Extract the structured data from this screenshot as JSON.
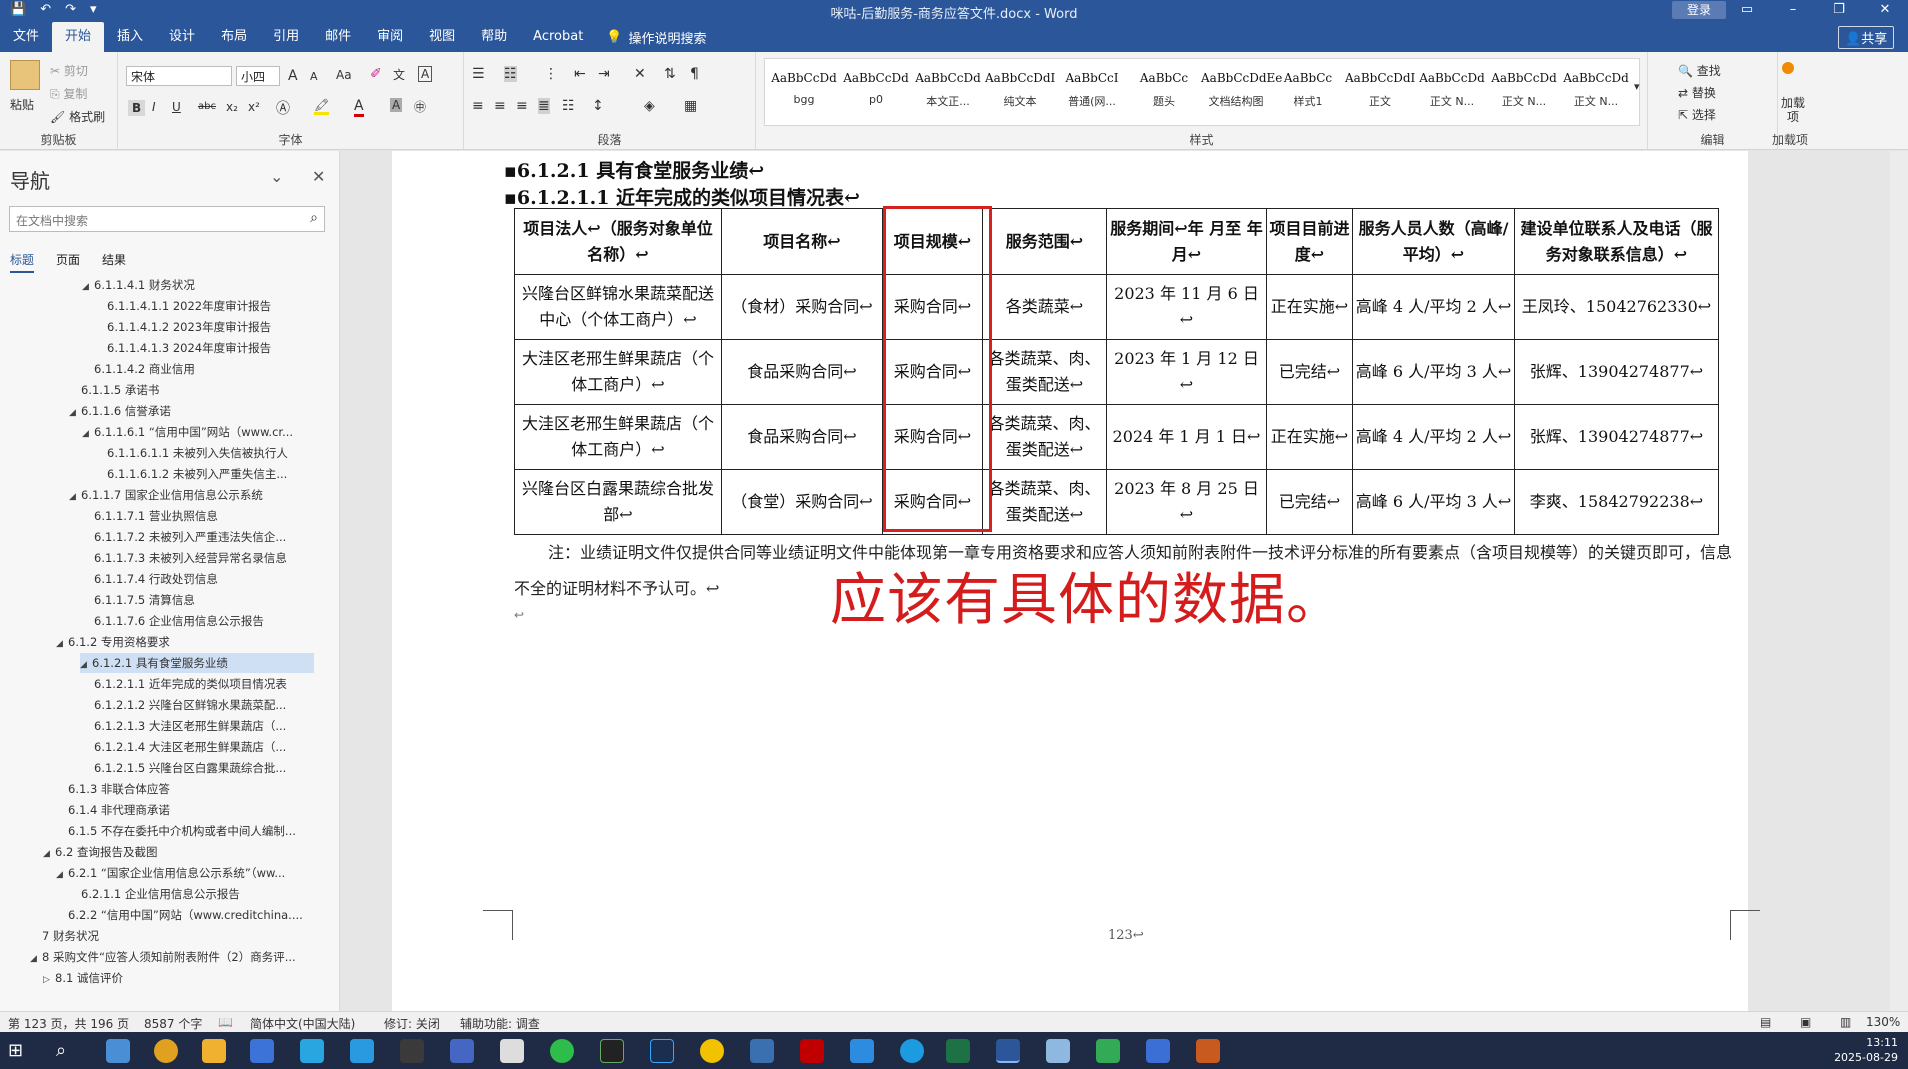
{
  "titlebar": {
    "title": "咪咕-后勤服务-商务应答文件.docx  -  Word",
    "login": "登录",
    "qa_save": "💾",
    "qa_undo": "↶",
    "qa_redo": "↷",
    "qa_more": "▾"
  },
  "tabs": [
    "文件",
    "开始",
    "插入",
    "设计",
    "布局",
    "引用",
    "邮件",
    "审阅",
    "视图",
    "帮助",
    "Acrobat"
  ],
  "tell_me": "操作说明搜索",
  "share": "共享",
  "ribbon": {
    "clipboard": {
      "paste": "粘贴",
      "cut": "剪切",
      "copy": "复制",
      "format_painter": "格式刷",
      "name": "剪贴板"
    },
    "font": {
      "font_name": "宋体",
      "font_size": "小四",
      "name": "字体",
      "grow": "A",
      "shrink": "A",
      "case": "Aa",
      "bold": "B",
      "italic": "I",
      "underline": "U",
      "strike": "abc",
      "sub": "x₂",
      "sup": "x²"
    },
    "paragraph": {
      "name": "段落"
    },
    "styles": {
      "name": "样式",
      "items": [
        {
          "sample": "AaBbCcDd",
          "name": "bgg"
        },
        {
          "sample": "AaBbCcDd",
          "name": "p0"
        },
        {
          "sample": "AaBbCcDd",
          "name": "本文正..."
        },
        {
          "sample": "AaBbCcDdI",
          "name": "纯文本"
        },
        {
          "sample": "AaBbCcI",
          "name": "普通(网..."
        },
        {
          "sample": "AaBbCc",
          "name": "题头"
        },
        {
          "sample": "AaBbCcDdEe",
          "name": "文档结构图"
        },
        {
          "sample": "AaBbCc",
          "name": "样式1"
        },
        {
          "sample": "AaBbCcDdI",
          "name": "正文"
        },
        {
          "sample": "AaBbCcDd",
          "name": "正文 N..."
        },
        {
          "sample": "AaBbCcDd",
          "name": "正文 N..."
        },
        {
          "sample": "AaBbCcDd",
          "name": "正文 N..."
        }
      ]
    },
    "editing": {
      "find": "查找",
      "replace": "替换",
      "select": "选择",
      "name": "编辑"
    },
    "addins": {
      "label": "加载项",
      "name": "加载项"
    }
  },
  "nav": {
    "title": "导航",
    "search_placeholder": "在文档中搜索",
    "tabs": [
      "标题",
      "页面",
      "结果"
    ],
    "outline": [
      {
        "t": "6.1.1.4.1 财务状况",
        "lvl": 4,
        "tri": "◢"
      },
      {
        "t": "6.1.1.4.1.1 2022年度审计报告",
        "lvl": 5,
        "tri": ""
      },
      {
        "t": "6.1.1.4.1.2 2023年度审计报告",
        "lvl": 5,
        "tri": ""
      },
      {
        "t": "6.1.1.4.1.3 2024年度审计报告",
        "lvl": 5,
        "tri": ""
      },
      {
        "t": "6.1.1.4.2 商业信用",
        "lvl": 4,
        "tri": ""
      },
      {
        "t": "6.1.1.5 承诺书",
        "lvl": 3,
        "tri": ""
      },
      {
        "t": "6.1.1.6 信誉承诺",
        "lvl": 3,
        "tri": "◢"
      },
      {
        "t": "6.1.1.6.1 “信用中国”网站（www.cr...",
        "lvl": 4,
        "tri": "◢"
      },
      {
        "t": "6.1.1.6.1.1 未被列入失信被执行人",
        "lvl": 5,
        "tri": ""
      },
      {
        "t": "6.1.1.6.1.2 未被列入严重失信主...",
        "lvl": 5,
        "tri": ""
      },
      {
        "t": "6.1.1.7 国家企业信用信息公示系统",
        "lvl": 3,
        "tri": "◢"
      },
      {
        "t": "6.1.1.7.1 营业执照信息",
        "lvl": 4,
        "tri": ""
      },
      {
        "t": "6.1.1.7.2 未被列入严重违法失信企...",
        "lvl": 4,
        "tri": ""
      },
      {
        "t": "6.1.1.7.3 未被列入经营异常名录信息",
        "lvl": 4,
        "tri": ""
      },
      {
        "t": "6.1.1.7.4 行政处罚信息",
        "lvl": 4,
        "tri": ""
      },
      {
        "t": "6.1.1.7.5 清算信息",
        "lvl": 4,
        "tri": ""
      },
      {
        "t": "6.1.1.7.6 企业信用信息公示报告",
        "lvl": 4,
        "tri": ""
      },
      {
        "t": "6.1.2 专用资格要求",
        "lvl": 2,
        "tri": "◢"
      },
      {
        "t": "6.1.2.1 具有食堂服务业绩",
        "lvl": 3,
        "tri": "◢",
        "sel": true
      },
      {
        "t": "6.1.2.1.1 近年完成的类似项目情况表",
        "lvl": 4,
        "tri": ""
      },
      {
        "t": "6.1.2.1.2 兴隆台区鲜锦水果蔬菜配...",
        "lvl": 4,
        "tri": ""
      },
      {
        "t": "6.1.2.1.3 大洼区老邢生鲜果蔬店（...",
        "lvl": 4,
        "tri": ""
      },
      {
        "t": "6.1.2.1.4 大洼区老邢生鲜果蔬店（...",
        "lvl": 4,
        "tri": ""
      },
      {
        "t": "6.1.2.1.5 兴隆台区白露果蔬综合批...",
        "lvl": 4,
        "tri": ""
      },
      {
        "t": "6.1.3 非联合体应答",
        "lvl": 2,
        "tri": ""
      },
      {
        "t": "6.1.4 非代理商承诺",
        "lvl": 2,
        "tri": ""
      },
      {
        "t": "6.1.5 不存在委托中介机构或者中间人编制...",
        "lvl": 2,
        "tri": ""
      },
      {
        "t": "6.2 查询报告及截图",
        "lvl": 1,
        "tri": "◢"
      },
      {
        "t": "6.2.1 “国家企业信用信息公示系统”（ww...",
        "lvl": 2,
        "tri": "◢"
      },
      {
        "t": "6.2.1.1 企业信用信息公示报告",
        "lvl": 3,
        "tri": ""
      },
      {
        "t": "6.2.2 “信用中国”网站（www.creditchina....",
        "lvl": 2,
        "tri": ""
      },
      {
        "t": "7 财务状况",
        "lvl": 0,
        "tri": ""
      },
      {
        "t": "8 采购文件“应答人须知前附表附件（2）商务评...",
        "lvl": 0,
        "tri": "◢"
      },
      {
        "t": "8.1 诚信评价",
        "lvl": 1,
        "tri": "▷"
      }
    ]
  },
  "doc": {
    "heading1": "▪6.1.2.1  具有食堂服务业绩↩",
    "heading2": "▪6.1.2.1.1 近年完成的类似项目情况表↩",
    "table": {
      "headers": [
        "项目法人↩（服务对象单位名称）↩",
        "项目名称↩",
        "项目规模↩",
        "服务范围↩",
        "服务期间↩年 月至 年 月↩",
        "项目目前进度↩",
        "服务人员人数（高峰/平均）↩",
        "建设单位联系人及电话（服务对象联系信息）↩"
      ],
      "rows": [
        [
          "兴隆台区鲜锦水果蔬菜配送中心（个体工商户）↩",
          "（食材）采购合同↩",
          "采购合同↩",
          "各类蔬菜↩",
          "2023 年 11 月 6 日↩",
          "正在实施↩",
          "高峰 4 人/平均 2 人↩",
          "王凤玲、15042762330↩"
        ],
        [
          "大洼区老邢生鲜果蔬店（个体工商户）↩",
          "食品采购合同↩",
          "采购合同↩",
          "各类蔬菜、肉、蛋类配送↩",
          "2023 年 1 月 12 日↩",
          "已完结↩",
          "高峰 6 人/平均 3 人↩",
          "张辉、13904274877↩"
        ],
        [
          "大洼区老邢生鲜果蔬店（个体工商户）↩",
          "食品采购合同↩",
          "采购合同↩",
          "各类蔬菜、肉、蛋类配送↩",
          "2024 年 1 月 1 日↩",
          "正在实施↩",
          "高峰 4 人/平均 2 人↩",
          "张辉、13904274877↩"
        ],
        [
          "兴隆台区白露果蔬综合批发部↩",
          "（食堂）采购合同↩",
          "采购合同↩",
          "各类蔬菜、肉、蛋类配送↩",
          "2023 年 8 月 25 日↩",
          "已完结↩",
          "高峰 6 人/平均 3 人↩",
          "李爽、15842792238↩"
        ]
      ]
    },
    "note": "注：业绩证明文件仅提供合同等业绩证明文件中能体现第一章专用资格要求和应答人须知前附表附件一技术评分标准的所有要素点（含项目规模等）的关键页即可，信息不全的证明材料不予认可。↩",
    "empty_para": "↩",
    "annotation": "应该有具体的数据。",
    "page_number": "123↩"
  },
  "status": {
    "page": "第 123 页，共 196 页",
    "words": "8587 个字",
    "lang": "简体中文(中国大陆)",
    "track": "修订: 关闭",
    "access": "辅助功能: 调查",
    "zoom": "130%"
  },
  "clock": {
    "time": "13:11",
    "date": "2025-08-29"
  },
  "colors": {
    "accent": "#2b579a",
    "annotation_red": "#d51c1c"
  }
}
